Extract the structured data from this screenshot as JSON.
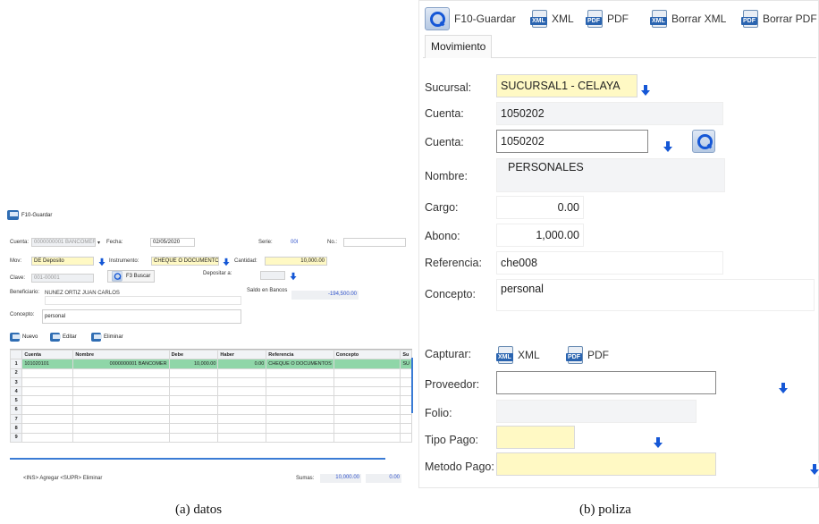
{
  "panel_a": {
    "toolbar": {
      "save_label": "F10-Guardar"
    },
    "form": {
      "cuenta_label": "Cuenta:",
      "cuenta_value": "0000000001 BANCOMER",
      "fecha_label": "Fecha:",
      "fecha_value": "02/05/2020",
      "serie_label": "Serie:",
      "serie_value": "00I",
      "no_label": "No.:",
      "mov_label": "Mov:",
      "mov_value": "DE Deposito",
      "instrumento_label": "Instrumento:",
      "instrumento_value": "CHEQUE O DOCUMENTOS",
      "cantidad_label": "Cantidad:",
      "cantidad_value": "10,000.00",
      "clave_label": "Clave:",
      "clave_value": "001-00001",
      "buscar_label": "F3 Buscar",
      "depositar_label": "Depositar a:",
      "beneficiario_label": "Beneficiario:",
      "beneficiario_value": "NUNEZ ORTIZ JUAN CARLOS",
      "saldo_label": "Saldo en Bancos",
      "saldo_value": "-194,500.00",
      "concepto_label": "Concepto:",
      "concepto_value": "personal"
    },
    "grid_toolbar": {
      "nuevo": "Nuevo",
      "editar": "Editar",
      "eliminar": "Eliminar"
    },
    "grid": {
      "columns": [
        "Cuenta",
        "Nombre",
        "Debe",
        "Haber",
        "Referencia",
        "Concepto",
        "Su"
      ],
      "rows": [
        [
          "101020101",
          "0000000001 BANCOMER",
          "10,000.00",
          "0.00",
          "CHEQUE O DOCUMENTOS",
          "",
          "SU"
        ],
        [
          "",
          "",
          "",
          "",
          "",
          "",
          ""
        ],
        [
          "",
          "",
          "",
          "",
          "",
          "",
          ""
        ],
        [
          "",
          "",
          "",
          "",
          "",
          "",
          ""
        ],
        [
          "",
          "",
          "",
          "",
          "",
          "",
          ""
        ],
        [
          "",
          "",
          "",
          "",
          "",
          "",
          ""
        ],
        [
          "",
          "",
          "",
          "",
          "",
          "",
          ""
        ],
        [
          "",
          "",
          "",
          "",
          "",
          "",
          ""
        ],
        [
          "",
          "",
          "",
          "",
          "",
          "",
          ""
        ]
      ],
      "row_numbers": [
        "1",
        "2",
        "3",
        "4",
        "5",
        "6",
        "7",
        "8",
        "9"
      ]
    },
    "footer": {
      "hint": "<INS> Agregar   <SUPR> Eliminar",
      "sumas_label": "Sumas:",
      "sumas_debe": "10,000.00",
      "sumas_haber": "0.00"
    }
  },
  "panel_b": {
    "toolbar": {
      "save_label": "F10-Guardar",
      "xml_label": "XML",
      "pdf_label": "PDF",
      "borrar_xml_label": "Borrar XML",
      "borrar_pdf_label": "Borrar PDF"
    },
    "tab_label": "Movimiento",
    "form": {
      "sucursal_label": "Sucursal:",
      "sucursal_value": "SUCURSAL1 - CELAYA",
      "cuenta1_label": "Cuenta:",
      "cuenta1_value": "1050202",
      "cuenta2_label": "Cuenta:",
      "cuenta2_value": "1050202",
      "nombre_label": "Nombre:",
      "nombre_value": "PERSONALES",
      "cargo_label": "Cargo:",
      "cargo_value": "0.00",
      "abono_label": "Abono:",
      "abono_value": "1,000.00",
      "referencia_label": "Referencia:",
      "referencia_value": "che008",
      "concepto_label": "Concepto:",
      "concepto_value": "personal",
      "capturar_label": "Capturar:",
      "capturar_xml": "XML",
      "capturar_pdf": "PDF",
      "proveedor_label": "Proveedor:",
      "folio_label": "Folio:",
      "tipo_pago_label": "Tipo Pago:",
      "metodo_pago_label": "Metodo Pago:"
    }
  },
  "captions": {
    "a": "(a)  datos",
    "b": "(b)  poliza"
  }
}
